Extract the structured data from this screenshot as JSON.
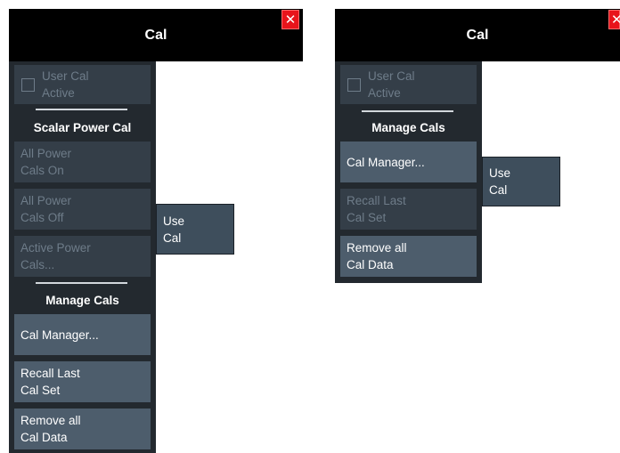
{
  "left": {
    "title": "Cal",
    "close_icon": "close-icon",
    "user_cal": {
      "line1": "User Cal",
      "line2": "Active"
    },
    "scalar_label": "Scalar Power Cal",
    "all_on": {
      "line1": "All Power",
      "line2": "Cals On"
    },
    "all_off": {
      "line1": "All Power",
      "line2": "Cals Off"
    },
    "active_power": {
      "line1": "Active Power",
      "line2": "Cals..."
    },
    "manage_label": "Manage Cals",
    "cal_manager": "Cal Manager...",
    "recall": {
      "line1": "Recall Last",
      "line2": "Cal Set"
    },
    "remove": {
      "line1": "Remove all",
      "line2": "Cal Data"
    },
    "use_cal": {
      "line1": "Use",
      "line2": "Cal"
    }
  },
  "right": {
    "title": "Cal",
    "close_icon": "close-icon",
    "user_cal": {
      "line1": "User Cal",
      "line2": "Active"
    },
    "manage_label": "Manage Cals",
    "cal_manager": "Cal Manager...",
    "recall": {
      "line1": "Recall Last",
      "line2": "Cal Set"
    },
    "remove": {
      "line1": "Remove all",
      "line2": "Cal Data"
    },
    "use_cal": {
      "line1": "Use",
      "line2": "Cal"
    }
  },
  "colors": {
    "header_bg": "#000000",
    "close_red": "#e8141b",
    "panel_bg": "#23292f",
    "button_bg": "#4d5d6c",
    "disabled_bg": "#343e48",
    "disabled_text": "#6e7c89"
  }
}
